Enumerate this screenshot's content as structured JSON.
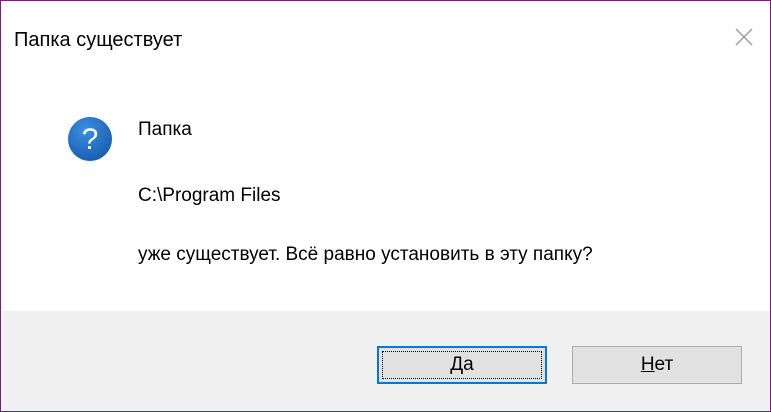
{
  "dialog": {
    "title": "Папка существует",
    "icon": "question-icon",
    "message": {
      "line1": "Папка",
      "line2": "C:\\Program Files",
      "line3": "уже существует. Всё равно установить в эту папку?"
    },
    "buttons": {
      "yes": {
        "mnemonic": "Д",
        "rest": "а"
      },
      "no": {
        "mnemonic": "Н",
        "rest": "ет"
      }
    },
    "colors": {
      "accent": "#0078d7",
      "border": "#7a1e7a",
      "footer": "#f0f0f0"
    }
  }
}
